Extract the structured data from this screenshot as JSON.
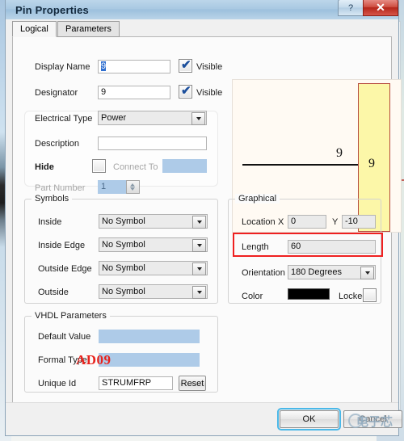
{
  "window": {
    "title": "Pin Properties",
    "help_label": "?",
    "close_label": "✕"
  },
  "tabs": [
    {
      "label": "Logical",
      "active": true
    },
    {
      "label": "Parameters",
      "active": false
    }
  ],
  "logical": {
    "display_name": {
      "label": "Display Name",
      "value": "9",
      "visible_label": "Visible",
      "visible_checked": true,
      "tick": "✔"
    },
    "designator": {
      "label": "Designator",
      "value": "9",
      "visible_label": "Visible",
      "visible_checked": true,
      "tick": "✔"
    },
    "electrical_type": {
      "label": "Electrical Type",
      "value": "Power"
    },
    "description": {
      "label": "Description",
      "value": ""
    },
    "hide": {
      "label": "Hide",
      "checked": false
    },
    "connect_to": {
      "label": "Connect To",
      "value": ""
    },
    "part_number": {
      "label": "Part Number",
      "value": "1"
    }
  },
  "symbols": {
    "title": "Symbols",
    "rows": [
      {
        "label": "Inside",
        "value": "No Symbol"
      },
      {
        "label": "Inside Edge",
        "value": "No Symbol"
      },
      {
        "label": "Outside Edge",
        "value": "No Symbol"
      },
      {
        "label": "Outside",
        "value": "No Symbol"
      }
    ]
  },
  "graphical": {
    "title": "Graphical",
    "location_label": "Location",
    "x_label": "X",
    "x_value": "0",
    "y_label": "Y",
    "y_value": "-10",
    "length_label": "Length",
    "length_value": "60",
    "orientation_label": "Orientation",
    "orientation_value": "180 Degrees",
    "color_label": "Color",
    "color_value": "#000000",
    "locked_label": "Locked",
    "locked_checked": false
  },
  "vhdl": {
    "title": "VHDL Parameters",
    "default_value_label": "Default Value",
    "default_value": "",
    "formal_type_label": "Formal Type",
    "formal_type": "",
    "unique_id_label": "Unique Id",
    "unique_id_value": "STRUMFRP",
    "reset_label": "Reset"
  },
  "preview": {
    "pin_name": "9",
    "body_pin_number": "9"
  },
  "annotation": {
    "ad_tag": "AD09"
  },
  "footer": {
    "ok_label": "OK",
    "cancel_label": "Cancel",
    "watermark_text": "电子芯"
  }
}
